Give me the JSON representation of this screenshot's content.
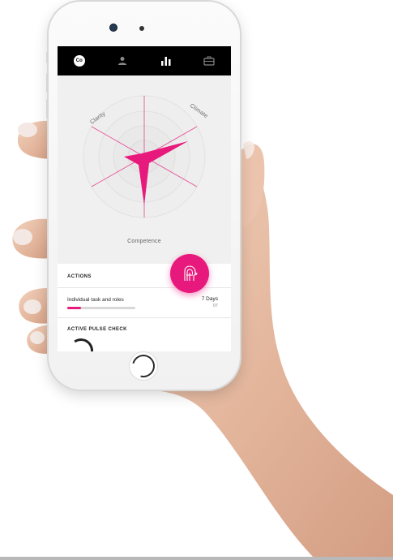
{
  "colors": {
    "accent": "#e8197c",
    "navbar": "#000000",
    "radar_rings": "#e4e4e4",
    "radar_axes": "#e8197c"
  },
  "navbar": {
    "logo_text": "Co",
    "items": [
      {
        "icon": "logo-icon"
      },
      {
        "icon": "person-icon"
      },
      {
        "icon": "bar-chart-icon"
      },
      {
        "icon": "briefcase-icon"
      }
    ],
    "active_index": 2
  },
  "radar": {
    "axes": [
      "Clarity",
      "Climate",
      "Competence"
    ]
  },
  "actions": {
    "title": "ACTIONS",
    "task": {
      "label": "Individual task and roles",
      "days": "7 Days",
      "sub": "07",
      "progress": 0.2
    }
  },
  "pulse": {
    "title": "ACTIVE PULSE CHECK"
  },
  "fab": {
    "icon": "pulse-person-icon"
  },
  "home_button": {
    "icon": "home-icon"
  }
}
